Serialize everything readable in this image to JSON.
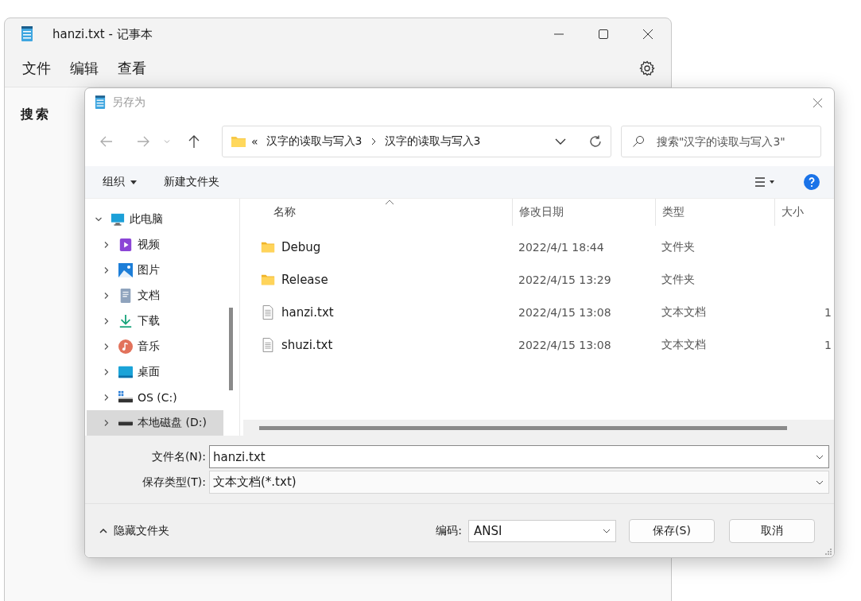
{
  "notepad": {
    "title": "hanzi.txt - 记事本",
    "menu": [
      "文件",
      "编辑",
      "查看"
    ],
    "content": "搜索"
  },
  "dialog": {
    "title": "另存为",
    "address": {
      "prefix": "«",
      "path": [
        "汉字的读取与写入3",
        "汉字的读取与写入3"
      ]
    },
    "search": {
      "placeholder": "搜索\"汉字的读取与写入3\""
    },
    "toolbar": {
      "organize": "组织",
      "new_folder": "新建文件夹"
    },
    "tree": [
      {
        "label": "此电脑",
        "kind": "pc",
        "expanded": true,
        "selected": false,
        "children": [
          {
            "label": "视频",
            "kind": "video",
            "expanded": false,
            "selected": false
          },
          {
            "label": "图片",
            "kind": "pictures",
            "expanded": false,
            "selected": false
          },
          {
            "label": "文档",
            "kind": "documents",
            "expanded": false,
            "selected": false
          },
          {
            "label": "下载",
            "kind": "download",
            "expanded": false,
            "selected": false
          },
          {
            "label": "音乐",
            "kind": "music",
            "expanded": false,
            "selected": false
          },
          {
            "label": "桌面",
            "kind": "desktop",
            "expanded": false,
            "selected": false
          },
          {
            "label": "OS (C:)",
            "kind": "system-drive",
            "expanded": false,
            "selected": false
          },
          {
            "label": "本地磁盘 (D:)",
            "kind": "drive",
            "expanded": false,
            "selected": true
          }
        ]
      }
    ],
    "columns": [
      {
        "label": "名称",
        "sorted": true
      },
      {
        "label": "修改日期",
        "sorted": false
      },
      {
        "label": "类型",
        "sorted": false
      },
      {
        "label": "大小",
        "sorted": false
      }
    ],
    "files": [
      {
        "name": "Debug",
        "kind": "folder",
        "date": "2022/4/1 18:44",
        "type": "文件夹"
      },
      {
        "name": "Release",
        "kind": "folder",
        "date": "2022/4/15 13:29",
        "type": "文件夹"
      },
      {
        "name": "hanzi.txt",
        "kind": "file",
        "date": "2022/4/15 13:08",
        "type": "文本文档",
        "size": "1"
      },
      {
        "name": "shuzi.txt",
        "kind": "file",
        "date": "2022/4/15 13:08",
        "type": "文本文档",
        "size": "1"
      }
    ],
    "filename": {
      "label": "文件名(N):",
      "value": "hanzi.txt"
    },
    "filetype": {
      "label": "保存类型(T):",
      "value": "文本文档(*.txt)"
    },
    "hide_folders": "隐藏文件夹",
    "encoding": {
      "label": "编码:",
      "value": "ANSI"
    },
    "buttons": [
      "保存(S)",
      "取消"
    ]
  }
}
